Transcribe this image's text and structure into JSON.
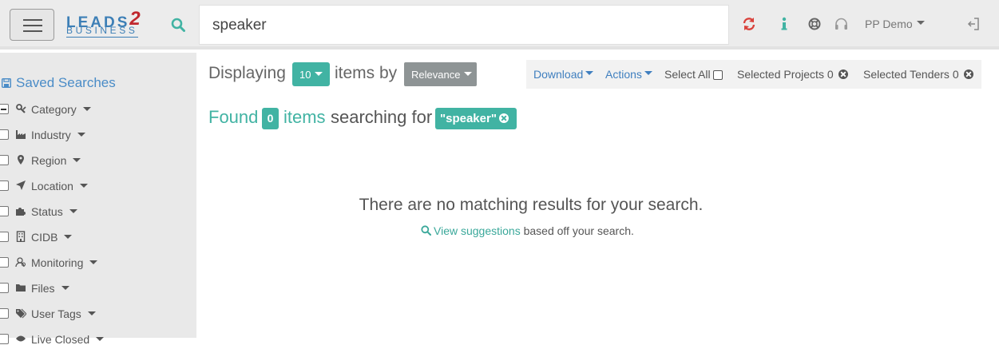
{
  "header": {
    "logo_line1": "LEADS",
    "logo_line1_num": "2",
    "logo_line2": "BUSINESS",
    "search_value": "speaker",
    "user_menu": "PP Demo",
    "icons": [
      "menu-icon",
      "search-icon",
      "refresh-icon",
      "info-icon",
      "lifebuoy-icon",
      "headset-icon",
      "logout-icon"
    ],
    "colors": {
      "accent": "#41b3a3",
      "brand_blue": "#3d7fb6",
      "refresh_red": "#d9423c"
    }
  },
  "sidebar": {
    "saved_searches": "Saved Searches",
    "filters": [
      {
        "label": "Category",
        "icon": "tools-icon",
        "checked": "partial"
      },
      {
        "label": "Industry",
        "icon": "industry-icon",
        "checked": "no"
      },
      {
        "label": "Region",
        "icon": "map-marker-icon",
        "checked": "no"
      },
      {
        "label": "Location",
        "icon": "location-arrow-icon",
        "checked": "no"
      },
      {
        "label": "Status",
        "icon": "puzzle-icon",
        "checked": "no"
      },
      {
        "label": "CIDB",
        "icon": "building-icon",
        "checked": "no"
      },
      {
        "label": "Monitoring",
        "icon": "user-monitor-icon",
        "checked": "no"
      },
      {
        "label": "Files",
        "icon": "folder-icon",
        "checked": "no"
      },
      {
        "label": "User Tags",
        "icon": "tags-icon",
        "checked": "no"
      },
      {
        "label": "Live Closed",
        "icon": "eye-icon",
        "checked": "no"
      }
    ]
  },
  "main": {
    "displaying": "Displaying",
    "per_page": "10",
    "items_by": "items by",
    "sort": "Relevance",
    "actions": {
      "download": "Download",
      "actions": "Actions",
      "select_all": "Select All",
      "selected_projects": "Selected Projects 0",
      "selected_tenders": "Selected Tenders 0"
    },
    "found": "Found",
    "found_count": "0",
    "items_word": "items",
    "searching_for": "searching for",
    "query": "\"speaker\"",
    "no_results": "There are no matching results for your search.",
    "view_suggestions": "View suggestions",
    "based_off": " based off your search."
  }
}
